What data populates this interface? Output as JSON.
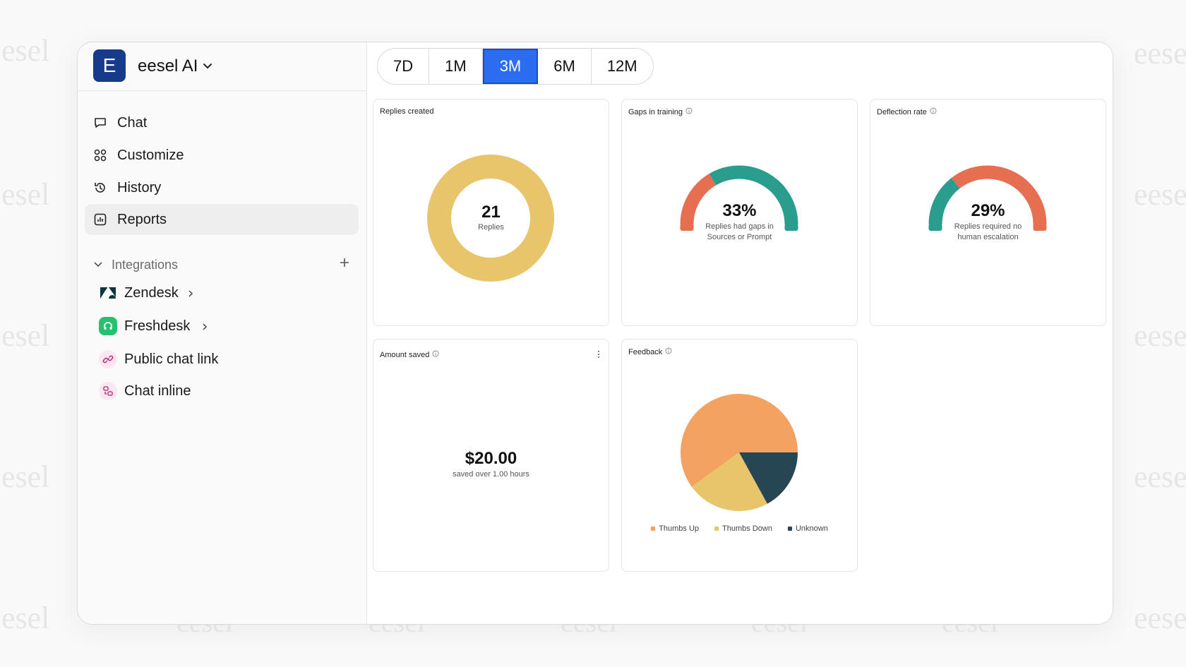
{
  "watermark": {
    "text": "esel",
    "text_right": "eese",
    "text_bottom": "eesel"
  },
  "workspace": {
    "logo_letter": "E",
    "name": "eesel AI"
  },
  "nav": [
    {
      "label": "Chat",
      "icon": "chat-bubble-icon",
      "active": false
    },
    {
      "label": "Customize",
      "icon": "grid-icon",
      "active": false
    },
    {
      "label": "History",
      "icon": "history-icon",
      "active": false
    },
    {
      "label": "Reports",
      "icon": "chart-icon",
      "active": true
    }
  ],
  "integrations": {
    "label": "Integrations",
    "items": [
      {
        "label": "Zendesk",
        "icon": "zendesk-icon"
      },
      {
        "label": "Freshdesk",
        "icon": "freshdesk-icon"
      },
      {
        "label": "Public chat link",
        "icon": "link-icon"
      },
      {
        "label": "Chat inline",
        "icon": "chat-inline-icon"
      }
    ]
  },
  "date_ranges": {
    "options": [
      "7D",
      "1M",
      "3M",
      "6M",
      "12M"
    ],
    "selected": "3M"
  },
  "colors": {
    "accent": "#2b6cf0",
    "gold": "#e8c46a",
    "teal": "#2a9d8f",
    "coral": "#e76f51",
    "orange": "#f3a261",
    "navy": "#264653"
  },
  "cards": {
    "replies": {
      "title": "Replies created",
      "value": "21",
      "label": "Replies"
    },
    "gaps": {
      "title": "Gaps in training",
      "value": "33%",
      "label_line1": "Replies had gaps in",
      "label_line2": "Sources or Prompt"
    },
    "deflection": {
      "title": "Deflection rate",
      "value": "29%",
      "label_line1": "Replies required no",
      "label_line2": "human escalation"
    },
    "saved": {
      "title": "Amount saved",
      "value": "$20.00",
      "label": "saved over 1.00 hours"
    },
    "feedback": {
      "title": "Feedback"
    }
  },
  "chart_data": [
    {
      "type": "pie",
      "title": "Replies created",
      "categories": [
        "Replies"
      ],
      "values": [
        21
      ]
    },
    {
      "type": "gauge",
      "title": "Gaps in training",
      "value_percent": 33
    },
    {
      "type": "gauge",
      "title": "Deflection rate",
      "value_percent": 29
    },
    {
      "type": "pie",
      "title": "Feedback",
      "categories": [
        "Thumbs Up",
        "Thumbs Down",
        "Unknown"
      ],
      "values": [
        60,
        23,
        17
      ],
      "colors": [
        "#f3a261",
        "#e8c46a",
        "#264653"
      ],
      "legend": "bottom"
    }
  ]
}
